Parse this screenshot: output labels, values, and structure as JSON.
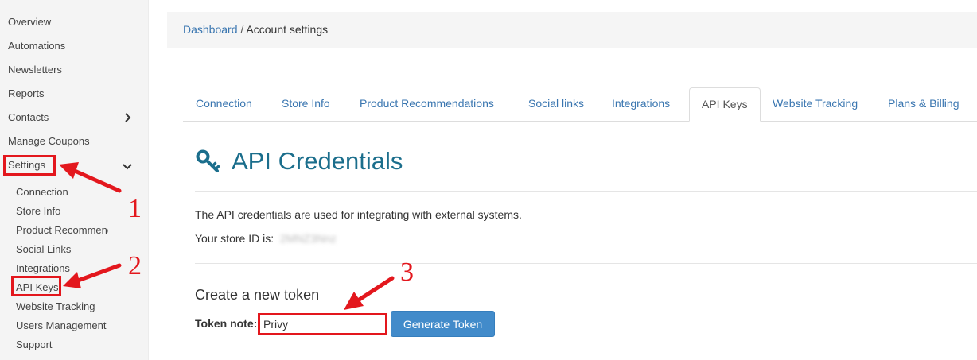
{
  "sidebar": {
    "items": [
      {
        "label": "Overview"
      },
      {
        "label": "Automations"
      },
      {
        "label": "Newsletters"
      },
      {
        "label": "Reports"
      },
      {
        "label": "Contacts"
      },
      {
        "label": "Manage Coupons"
      },
      {
        "label": "Settings"
      }
    ],
    "subitems": [
      {
        "label": "Connection"
      },
      {
        "label": "Store Info"
      },
      {
        "label": "Product Recommendations"
      },
      {
        "label": "Social Links"
      },
      {
        "label": "Integrations"
      },
      {
        "label": "API Keys"
      },
      {
        "label": "Website Tracking"
      },
      {
        "label": "Users Management"
      },
      {
        "label": "Support"
      }
    ]
  },
  "breadcrumb": {
    "link": "Dashboard",
    "separator": " / ",
    "current": "Account settings"
  },
  "tabs": [
    {
      "label": "Connection"
    },
    {
      "label": "Store Info"
    },
    {
      "label": "Product Recommendations"
    },
    {
      "label": "Social links"
    },
    {
      "label": "Integrations"
    },
    {
      "label": "API Keys",
      "active": true
    },
    {
      "label": "Website Tracking"
    },
    {
      "label": "Plans & Billing"
    }
  ],
  "main": {
    "heading": "API Credentials",
    "description": "The API credentials are used for integrating with external systems.",
    "store_id_label": "Your store ID is:",
    "store_id_value": "2MNZ3Nnz",
    "create_heading": "Create a new token",
    "token_note_label": "Token note:",
    "token_note_value": "Privy",
    "generate_button": "Generate Token"
  },
  "annotations": {
    "step1": "1",
    "step2": "2",
    "step3": "3",
    "color": "#e3171d"
  },
  "colors": {
    "link": "#3a76b0",
    "heading": "#1b6e8c",
    "button": "#428bca"
  }
}
